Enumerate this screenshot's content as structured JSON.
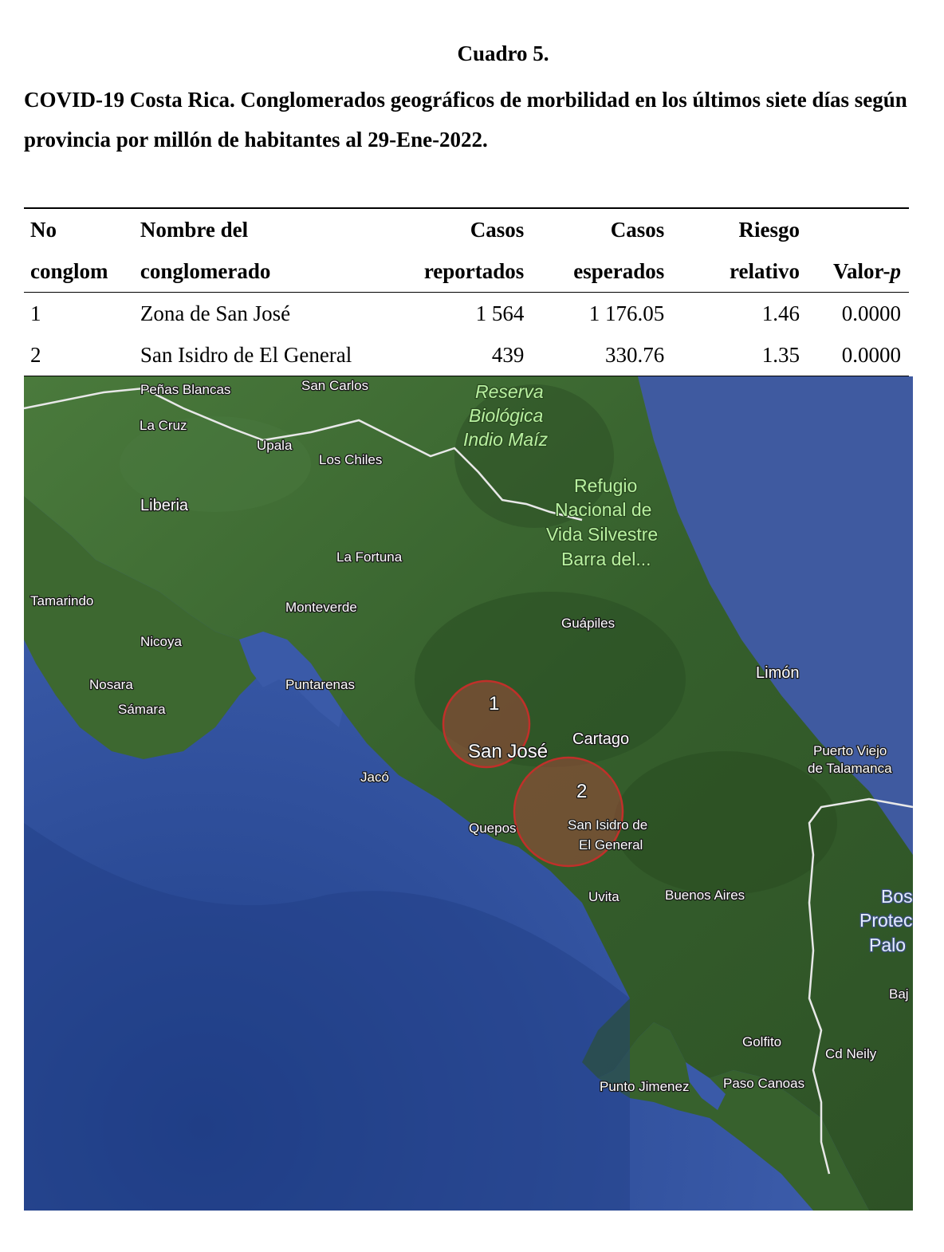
{
  "caption": {
    "number": "Cuadro 5.",
    "title": "COVID-19 Costa Rica. Conglomerados geográficos de morbilidad en los últimos siete días según provincia por millón de habitantes al 29-Ene-2022."
  },
  "table": {
    "headers_row1": [
      "No",
      "Nombre del",
      "Casos",
      "Casos",
      "Riesgo",
      ""
    ],
    "headers_row2": [
      "conglom",
      "conglomerado",
      "reportados",
      "esperados",
      "relativo",
      "Valor-"
    ],
    "header_p": "p",
    "rows": [
      [
        "1",
        "Zona de San José",
        "1 564",
        "1 176.05",
        "1.46",
        "0.0000"
      ],
      [
        "2",
        "San Isidro de El General",
        "439",
        "330.76",
        "1.35",
        "0.0000"
      ]
    ]
  },
  "map": {
    "colors": {
      "sea": "#3a5aa8",
      "deep_sea": "#1f3f88",
      "land": "#3e6a33",
      "cluster_fill": "#a0483a",
      "cluster_stroke": "#c0302a"
    },
    "clusters": [
      {
        "id": "1",
        "label": "1"
      },
      {
        "id": "2",
        "label": "2"
      }
    ],
    "places": {
      "penas_blancas": "Peñas Blancas",
      "san_carlos": "San Carlos",
      "la_cruz": "La Cruz",
      "upala": "Upala",
      "los_chiles": "Los Chiles",
      "liberia": "Liberia",
      "la_fortuna": "La Fortuna",
      "tamarindo": "Tamarindo",
      "monteverde": "Monteverde",
      "nicoya": "Nicoya",
      "nosara": "Nosara",
      "samara": "Sámara",
      "puntarenas": "Puntarenas",
      "guapiles": "Guápiles",
      "limon": "Limón",
      "san_jose": "San José",
      "cartago": "Cartago",
      "jaco": "Jacó",
      "quepos": "Quepos",
      "san_isidro_1": "San Isidro de",
      "san_isidro_2": "El General",
      "puerto_viejo_1": "Puerto Viejo",
      "puerto_viejo_2": "de Talamanca",
      "uvita": "Uvita",
      "buenos_aires": "Buenos Aires",
      "golfito": "Golfito",
      "cd_neily": "Cd Neily",
      "punto_jimenez": "Punto Jimenez",
      "paso_canoas": "Paso Canoas",
      "reserva_1": "Reserva",
      "reserva_2": "Biológica",
      "reserva_3": "Indio Maíz",
      "refugio_1": "Refugio",
      "refugio_2": "Nacional de",
      "refugio_3": "Vida Silvestre",
      "refugio_4": "Barra del...",
      "bos_1": "Bos",
      "bos_2": "Protec",
      "bos_3": "Palo",
      "baj": "Baj"
    }
  }
}
